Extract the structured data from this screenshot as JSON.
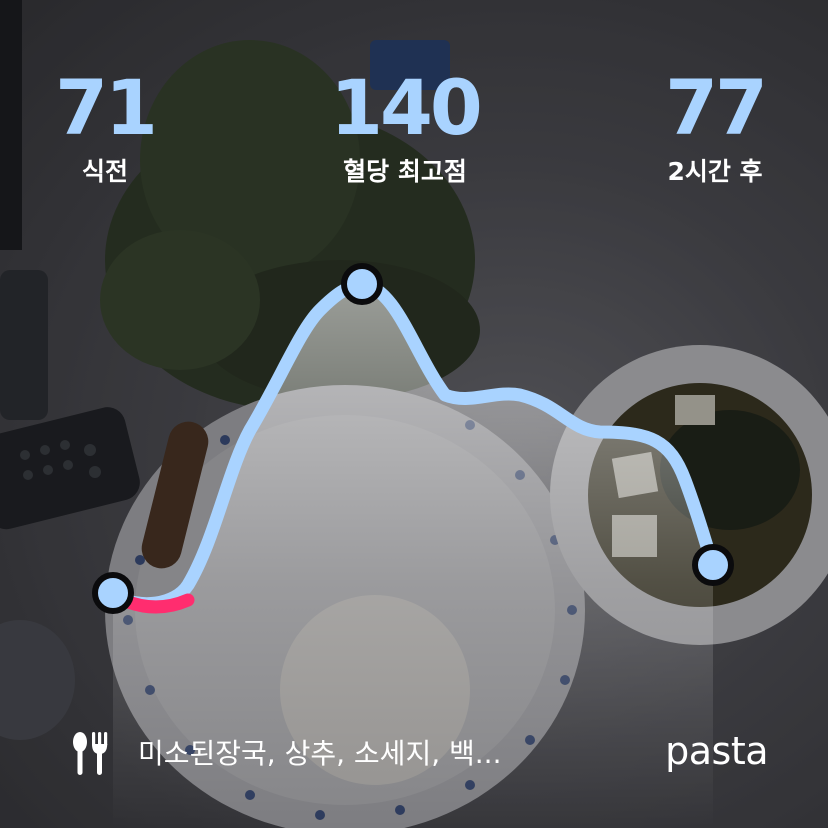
{
  "stats": {
    "before": {
      "value": "71",
      "label": "식전"
    },
    "peak": {
      "value": "140",
      "label": "혈당 최고점"
    },
    "after": {
      "value": "77",
      "label": "2시간 후"
    }
  },
  "meal": {
    "icon": "fork-knife-icon",
    "foods": "미소된장국, 상추, 소세지, 백..."
  },
  "brand": "pasta",
  "colors": {
    "curve": "#a9d3ff",
    "curve_highlight": "#ff2d6f",
    "stat_number": "#a9d3ff",
    "text": "#ffffff"
  }
}
